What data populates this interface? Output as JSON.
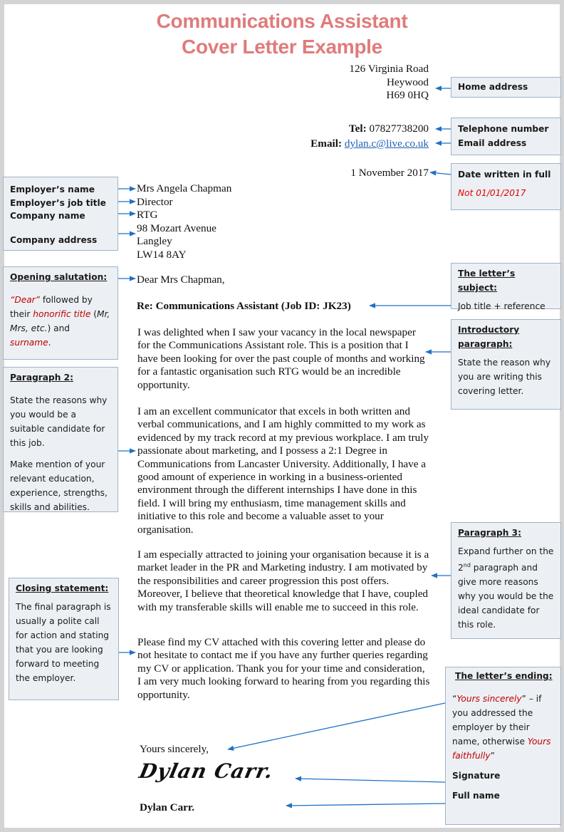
{
  "title": {
    "line1": "Communications Assistant",
    "line2": "Cover Letter Example"
  },
  "letter": {
    "sender_address": [
      "126 Virginia Road",
      "Heywood",
      "H69 0HQ"
    ],
    "tel_label": "Tel:",
    "tel_value": "07827738200",
    "email_label": "Email:",
    "email_value": "dylan.c@live.co.uk",
    "date": "1 November 2017",
    "recipient": {
      "name": "Mrs Angela Chapman",
      "job_title": "Director",
      "company": "RTG",
      "address": [
        "98 Mozart Avenue",
        "Langley",
        "LW14 8AY"
      ]
    },
    "salutation": "Dear Mrs Chapman,",
    "subject": "Re: Communications Assistant (Job ID: JK23)",
    "paragraphs": [
      "I was delighted when I saw your vacancy in the local newspaper for the Communications Assistant role. This is a position that I have been looking for over the past couple of months and working for a fantastic organisation such RTG would be an incredible opportunity.",
      "I am an excellent communicator that excels in both written and verbal communications, and I am highly committed to my work as evidenced by my track record at my previous workplace. I am truly passionate about marketing, and I possess a 2:1 Degree in Communications from Lancaster University. Additionally, I have a good amount of experience in working in a business-oriented environment through the different internships I have done in this field. I will bring my enthusiasm, time management skills and initiative to this role and become a valuable asset to your organisation.",
      "I am especially attracted to joining your organisation because it is a market leader in the PR and Marketing industry. I am motivated by the responsibilities and career progression this post offers. Moreover, I believe that theoretical knowledge that I have, coupled with my transferable skills will enable me to succeed in this role.",
      "Please find my CV attached with this covering letter and please do not hesitate to contact me if you have any further queries regarding my CV or application. Thank you for your time and consideration, I am very much looking forward to hearing from you regarding this opportunity."
    ],
    "closing": "Yours sincerely,",
    "signature": "Dylan Carr.",
    "full_name": "Dylan Carr."
  },
  "annotations": {
    "home_address": "Home address",
    "telephone": "Telephone number",
    "email": "Email address",
    "date_heading": "Date written in full",
    "date_note": "Not 01/01/2017",
    "employer_name": "Employer’s name",
    "employer_job_title": "Employer’s job title",
    "company_name": "Company name",
    "company_address": "Company address",
    "salutation": {
      "heading": "Opening salutation:",
      "dear": "“Dear”",
      "t1": " followed by their ",
      "honorific": "honorific title",
      "t2": " (",
      "examples": "Mr, Mrs, etc.",
      "t3": ") and ",
      "surname": "surname",
      "t4": "."
    },
    "subject": {
      "heading": "The letter’s subject:",
      "body": "Job title + reference"
    },
    "intro": {
      "heading": "Introductory paragraph:",
      "body": "State the reason why you are writing this covering letter."
    },
    "para2": {
      "heading": "Paragraph 2:",
      "body1": "State the reasons why you would be a suitable candidate for this job.",
      "body2": "Make mention of your relevant education, experience, strengths, skills and abilities."
    },
    "para3": {
      "heading": "Paragraph 3:",
      "body_a": "Expand further on the 2",
      "sup": "nd",
      "body_b": " paragraph and give more reasons why you would be the ideal candidate for this role."
    },
    "closing": {
      "heading": "Closing statement:",
      "body": "The final paragraph is usually a polite call for action and stating that you are looking forward to meeting the employer."
    },
    "ending": {
      "heading": "The letter’s ending:",
      "q_open": "“",
      "yours_sincerely": "Yours sincerely",
      "text1": "” – if you addressed the employer by their name, otherwise ",
      "yours_faithfully": "Yours faithfully",
      "q_close": "”",
      "signature": "Signature",
      "full_name": "Full name"
    }
  },
  "colors": {
    "title": "#e07b7b",
    "arrow": "#1f72c4",
    "box_bg": "#ecf0f4",
    "box_border": "#9fb3c8",
    "emphasis_red": "#c00000"
  }
}
